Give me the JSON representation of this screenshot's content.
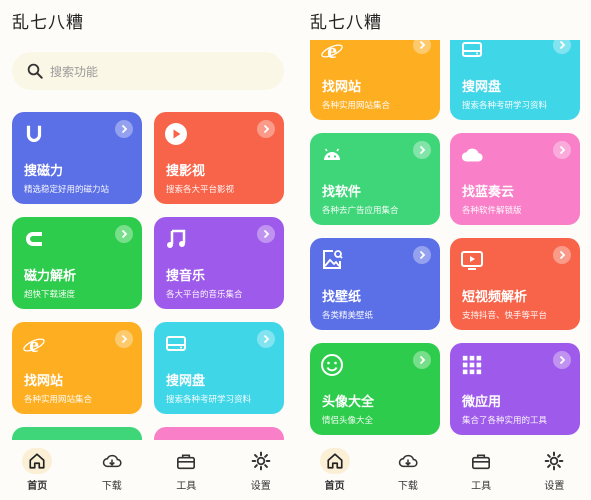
{
  "left": {
    "title": "乱七八糟",
    "search_placeholder": "搜索功能",
    "cards": [
      {
        "name": "搜磁力",
        "desc": "精选稳定好用的磁力站",
        "icon": "magnet-u-icon",
        "color": "#5b6fe6"
      },
      {
        "name": "搜影视",
        "desc": "搜索各大平台影视",
        "icon": "play-icon",
        "color": "#f7644a"
      },
      {
        "name": "磁力解析",
        "desc": "超快下载速度",
        "icon": "magnet-icon",
        "color": "#2ecc4c"
      },
      {
        "name": "搜音乐",
        "desc": "各大平台的音乐集合",
        "icon": "music-note-icon",
        "color": "#9e5aea"
      },
      {
        "name": "找网站",
        "desc": "各种实用网站集合",
        "icon": "browser-e-icon",
        "color": "#fdae21"
      },
      {
        "name": "搜网盘",
        "desc": "搜索各种考研学习资料",
        "icon": "drive-icon",
        "color": "#3fd6e8"
      }
    ]
  },
  "right": {
    "title": "乱七八糟",
    "cards": [
      {
        "name": "找网站",
        "desc": "各种实用网站集合",
        "icon": "browser-e-icon",
        "color": "#fdae21"
      },
      {
        "name": "搜网盘",
        "desc": "搜索各种考研学习资料",
        "icon": "drive-icon",
        "color": "#3fd6e8"
      },
      {
        "name": "找软件",
        "desc": "各种去广告应用集合",
        "icon": "android-icon",
        "color": "#3fd67a"
      },
      {
        "name": "找蓝奏云",
        "desc": "各种软件解锁版",
        "icon": "cloud-icon",
        "color": "#f87fc8"
      },
      {
        "name": "找壁纸",
        "desc": "各类精美壁纸",
        "icon": "image-search-icon",
        "color": "#5b6fe6"
      },
      {
        "name": "短视频解析",
        "desc": "支持抖音、快手等平台",
        "icon": "tv-icon",
        "color": "#f7644a"
      },
      {
        "name": "头像大全",
        "desc": "情侣头像大全",
        "icon": "smile-icon",
        "color": "#2ecc4c"
      },
      {
        "name": "微应用",
        "desc": "集合了各种实用的工具",
        "icon": "grid-apps-icon",
        "color": "#9e5aea"
      }
    ]
  },
  "nav": [
    {
      "label": "首页",
      "icon": "home-icon",
      "active": true
    },
    {
      "label": "下载",
      "icon": "cloud-download-icon",
      "active": false
    },
    {
      "label": "工具",
      "icon": "toolbox-icon",
      "active": false
    },
    {
      "label": "设置",
      "icon": "settings-gear-icon",
      "active": false
    }
  ],
  "colors": {
    "blue": "#5b6fe6",
    "red": "#f7644a",
    "green": "#2ecc4c",
    "purple": "#9e5aea",
    "orange": "#fdae21",
    "cyan": "#3fd6e8",
    "mint": "#3fd67a",
    "pink": "#f87fc8",
    "search_bg": "#fbf7e6",
    "nav_active_bg": "#fbf0d6"
  }
}
